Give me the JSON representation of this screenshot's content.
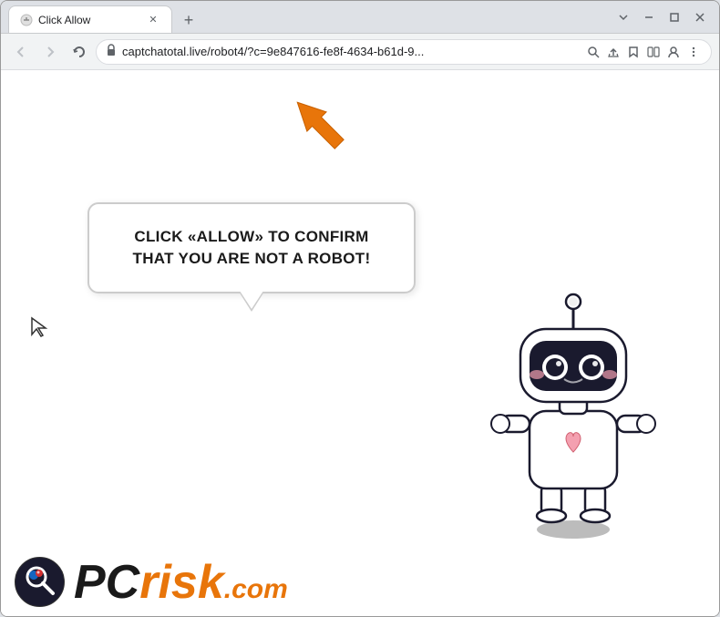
{
  "browser": {
    "tab": {
      "title": "Click Allow",
      "favicon": "🔒"
    },
    "new_tab_label": "+",
    "window_controls": {
      "chevron_down": "⌄",
      "minimize": "—",
      "maximize": "□",
      "close": "✕"
    },
    "address_bar": {
      "url": "captchatotal.live/robot4/?c=9e847616-fe8f-4634-b61d-9...",
      "lock_icon": "🔒"
    },
    "nav": {
      "back": "←",
      "forward": "→",
      "reload": "✕"
    }
  },
  "page": {
    "bubble_text": "CLICK «ALLOW» TO CONFIRM THAT YOU ARE NOT A ROBOT!",
    "watermark": {
      "pc": "PC",
      "risk": "risk",
      "com": ".com"
    }
  }
}
